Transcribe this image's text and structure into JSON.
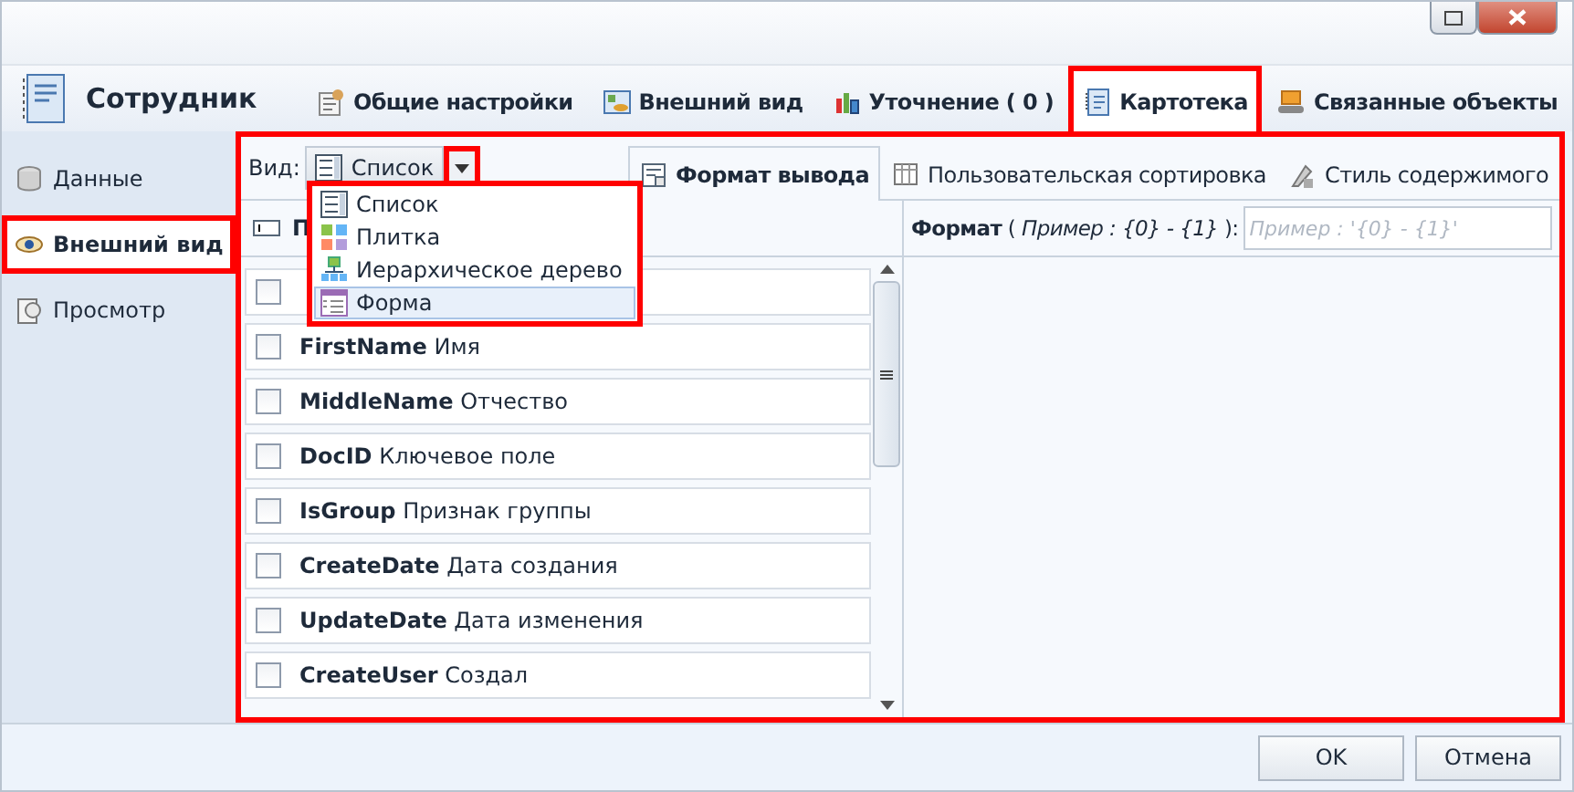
{
  "window": {
    "title": "Сотрудник"
  },
  "top_tabs": [
    {
      "label": "Общие настройки",
      "highlighted": false
    },
    {
      "label": "Внешний вид",
      "highlighted": false
    },
    {
      "label": "Уточнение ( 0 )",
      "highlighted": false
    },
    {
      "label": "Картотека",
      "highlighted": true
    },
    {
      "label": "Связанные объекты",
      "highlighted": false
    }
  ],
  "sidebar": {
    "items": [
      {
        "label": "Данные",
        "selected": false,
        "highlighted": false
      },
      {
        "label": "Внешний вид",
        "selected": true,
        "highlighted": true
      },
      {
        "label": "Просмотр",
        "selected": false,
        "highlighted": false
      }
    ]
  },
  "view": {
    "label": "Вид:",
    "value": "Список",
    "arrow_highlighted": true,
    "menu": {
      "highlighted": true,
      "items": [
        {
          "label": "Список",
          "selected": false
        },
        {
          "label": "Плитка",
          "selected": false
        },
        {
          "label": "Иерархическое дерево",
          "selected": false
        },
        {
          "label": "Форма",
          "selected": true
        }
      ]
    }
  },
  "sub_tabs": [
    {
      "label": "Формат вывода",
      "selected": true
    },
    {
      "label": "Пользовательская сортировка",
      "selected": false
    },
    {
      "label": "Стиль содержимого",
      "selected": false
    }
  ],
  "fields": {
    "header": "П",
    "rows": [
      {
        "checked": false
      },
      {
        "name": "FirstName",
        "caption": "Имя",
        "checked": false
      },
      {
        "name": "MiddleName",
        "caption": "Отчество",
        "checked": false
      },
      {
        "name": "DocID",
        "caption": "Ключевое поле",
        "checked": false
      },
      {
        "name": "IsGroup",
        "caption": "Признак группы",
        "checked": false
      },
      {
        "name": "CreateDate",
        "caption": "Дата создания",
        "checked": false
      },
      {
        "name": "UpdateDate",
        "caption": "Дата изменения",
        "checked": false
      },
      {
        "name": "CreateUser",
        "caption": "Создал",
        "checked": false
      }
    ]
  },
  "format": {
    "label": "**Формат** ( *Пример : {0} - {1}* ):",
    "placeholder": "Пример : '{0} - {1}'"
  },
  "panel_highlighted": true,
  "buttons": [
    "OK",
    "Отмена"
  ]
}
